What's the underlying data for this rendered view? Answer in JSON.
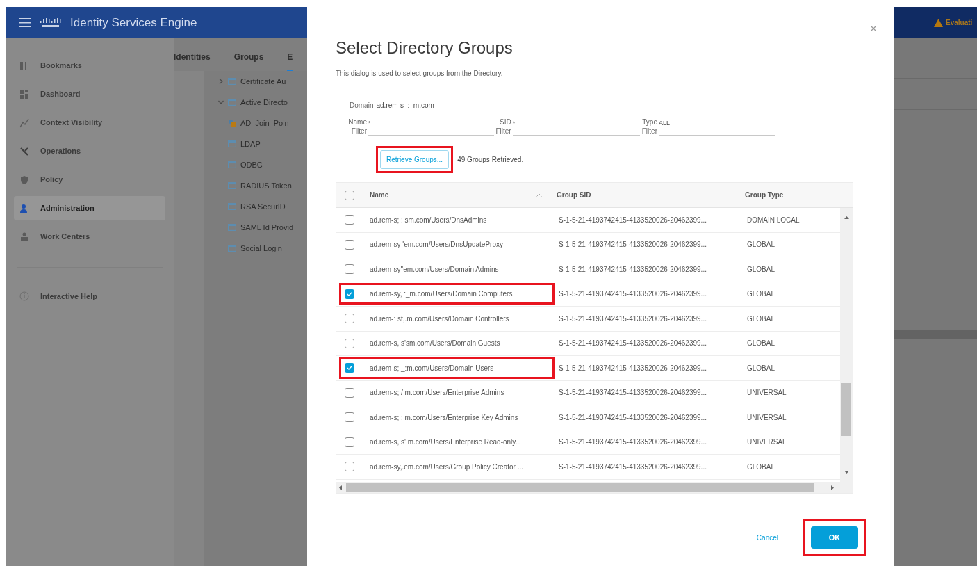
{
  "header": {
    "title": "Identity Services Engine",
    "alert": "Evaluati"
  },
  "sidebar": {
    "items": [
      {
        "label": "Bookmarks",
        "selected": false
      },
      {
        "label": "Dashboard",
        "selected": false
      },
      {
        "label": "Context Visibility",
        "selected": false
      },
      {
        "label": "Operations",
        "selected": false
      },
      {
        "label": "Policy",
        "selected": false
      },
      {
        "label": "Administration",
        "selected": true
      },
      {
        "label": "Work Centers",
        "selected": false
      }
    ],
    "help": "Interactive Help"
  },
  "tabs": [
    {
      "label": "Identities",
      "selected": false
    },
    {
      "label": "Groups",
      "selected": false
    },
    {
      "label": "E",
      "selected": true
    }
  ],
  "tree": [
    {
      "label": "Certificate Au",
      "kind": "folder",
      "expanded": false
    },
    {
      "label": "Active Directo",
      "kind": "folder",
      "expanded": true,
      "children": [
        {
          "label": "AD_Join_Poin",
          "kind": "join-point"
        }
      ]
    },
    {
      "label": "LDAP",
      "kind": "folder"
    },
    {
      "label": "ODBC",
      "kind": "folder"
    },
    {
      "label": "RADIUS Token",
      "kind": "folder"
    },
    {
      "label": "RSA SecurID",
      "kind": "folder"
    },
    {
      "label": "SAML Id Provid",
      "kind": "folder"
    },
    {
      "label": "Social Login",
      "kind": "folder"
    }
  ],
  "dialog": {
    "title": "Select Directory Groups",
    "description": "This dialog is used to select groups from the Directory.",
    "domain": {
      "label": "Domain",
      "value": "ad.rem-s  :  m.com"
    },
    "filters": [
      {
        "label_1": "Name",
        "label_2": "Filter",
        "value": "*"
      },
      {
        "label_1": "SID",
        "label_2": "Filter",
        "value": "*"
      },
      {
        "label_1": "Type",
        "label_2": "Filter",
        "value": "ALL"
      }
    ],
    "retrieve_button": {
      "label": "Retrieve Groups...",
      "highlighted": true
    },
    "retrieved": "49 Groups Retrieved.",
    "table": {
      "columns": [
        "Name",
        "Group SID",
        "Group Type"
      ],
      "all_checked": false,
      "rows": [
        {
          "name": "ad.rem-s; : sm.com/Users/DnsAdmins",
          "sid": "S-1-5-21-4193742415-4133520026-20462399...",
          "type": "DOMAIN LOCAL",
          "checked": false,
          "highlighted": false
        },
        {
          "name": "ad.rem-sy 'em.com/Users/DnsUpdateProxy",
          "sid": "S-1-5-21-4193742415-4133520026-20462399...",
          "type": "GLOBAL",
          "checked": false,
          "highlighted": false
        },
        {
          "name": "ad.rem-sy''em.com/Users/Domain Admins",
          "sid": "S-1-5-21-4193742415-4133520026-20462399...",
          "type": "GLOBAL",
          "checked": false,
          "highlighted": false
        },
        {
          "name": "ad.rem-sy, :_m.com/Users/Domain Computers",
          "sid": "S-1-5-21-4193742415-4133520026-20462399...",
          "type": "GLOBAL",
          "checked": true,
          "highlighted": true
        },
        {
          "name": "ad.rem-: st,.m.com/Users/Domain Controllers",
          "sid": "S-1-5-21-4193742415-4133520026-20462399...",
          "type": "GLOBAL",
          "checked": false,
          "highlighted": false
        },
        {
          "name": "ad.rem-s, s'sm.com/Users/Domain Guests",
          "sid": "S-1-5-21-4193742415-4133520026-20462399...",
          "type": "GLOBAL",
          "checked": false,
          "highlighted": false
        },
        {
          "name": "ad.rem-s; _:m.com/Users/Domain Users",
          "sid": "S-1-5-21-4193742415-4133520026-20462399...",
          "type": "GLOBAL",
          "checked": true,
          "highlighted": true
        },
        {
          "name": "ad.rem-s; / m.com/Users/Enterprise Admins",
          "sid": "S-1-5-21-4193742415-4133520026-20462399...",
          "type": "UNIVERSAL",
          "checked": false,
          "highlighted": false
        },
        {
          "name": "ad.rem-s; : m.com/Users/Enterprise Key Admins",
          "sid": "S-1-5-21-4193742415-4133520026-20462399...",
          "type": "UNIVERSAL",
          "checked": false,
          "highlighted": false
        },
        {
          "name": "ad.rem-s, s' m.com/Users/Enterprise Read-only...",
          "sid": "S-1-5-21-4193742415-4133520026-20462399...",
          "type": "UNIVERSAL",
          "checked": false,
          "highlighted": false
        },
        {
          "name": "ad.rem-sy,.em.com/Users/Group Policy Creator ...",
          "sid": "S-1-5-21-4193742415-4133520026-20462399...",
          "type": "GLOBAL",
          "checked": false,
          "highlighted": false
        }
      ]
    },
    "cancel": "Cancel",
    "ok": {
      "label": "OK",
      "highlighted": true
    }
  }
}
